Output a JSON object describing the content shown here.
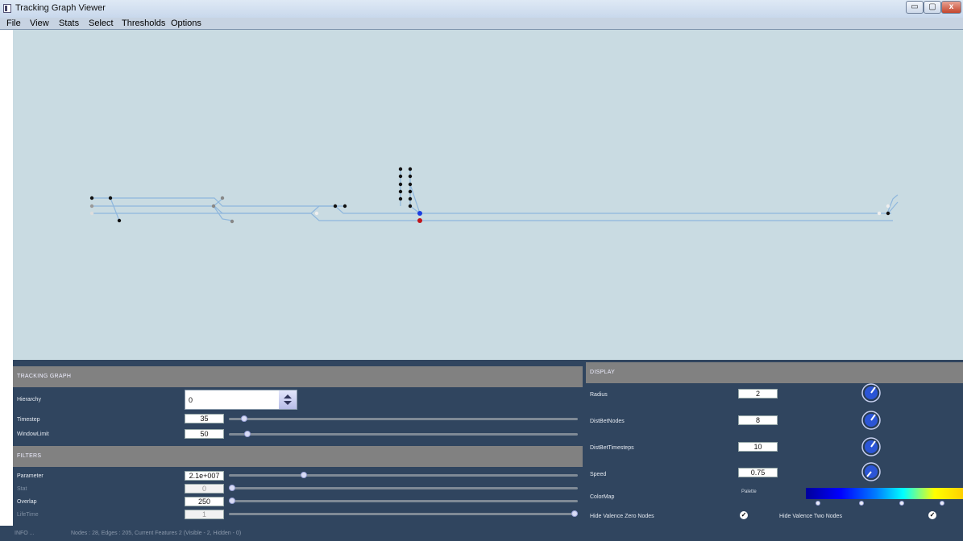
{
  "window": {
    "title": "Tracking Graph Viewer",
    "min_label": "▭",
    "max_label": "▢",
    "close_label": "x"
  },
  "menu": [
    "File",
    "View",
    "Stats",
    "Select",
    "Thresholds",
    "Options"
  ],
  "tracking_graph": {
    "header": "TRACKING GRAPH",
    "hierarchy_label": "Hierarchy",
    "hierarchy_value": "0",
    "timestep_label": "Timestep",
    "timestep_value": "35",
    "timestep_fraction": 0.035,
    "windowlimit_label": "WindowLimit",
    "windowlimit_value": "50",
    "windowlimit_fraction": 0.045
  },
  "filters": {
    "header": "FILTERS",
    "parameter_label": "Parameter",
    "parameter_value": "2.1e+007",
    "parameter_fraction": 0.21,
    "stat_label": "Stat",
    "stat_value": "0",
    "stat_fraction": 0.0,
    "overlap_label": "Overlap",
    "overlap_value": "250",
    "overlap_fraction": 0.0,
    "lifetime_label": "LifeTime",
    "lifetime_value": "1",
    "lifetime_fraction": 1.0
  },
  "display": {
    "header": "DISPLAY",
    "radius_label": "Radius",
    "radius_value": "2",
    "distbetnodes_label": "DistBetNodes",
    "distbetnodes_value": "8",
    "distbettimesteps_label": "DistBetTimesteps",
    "distbettimesteps_value": "10",
    "speed_label": "Speed",
    "speed_value": "0.75",
    "colormap_label": "ColorMap",
    "palette_label": "Palette",
    "hide_zero_label": "Hide Valence Zero Nodes",
    "hide_zero_checked": true,
    "hide_two_label": "Hide Valence Two Nodes",
    "hide_two_checked": true,
    "check_glyph": "✓"
  },
  "status": {
    "info": "INFO ...",
    "message": "Nodes : 28, Edges : 205, Current Features 2 (Visible - 2, Hidden - 0)"
  },
  "colors": {
    "canvas_bg": "#c9dbe2",
    "panel_bg": "#30455f",
    "header_bg": "#818181",
    "edge": "#8fb7dd",
    "selected_node_blue": "#1d3fe0",
    "selected_node_red": "#c0141a"
  }
}
